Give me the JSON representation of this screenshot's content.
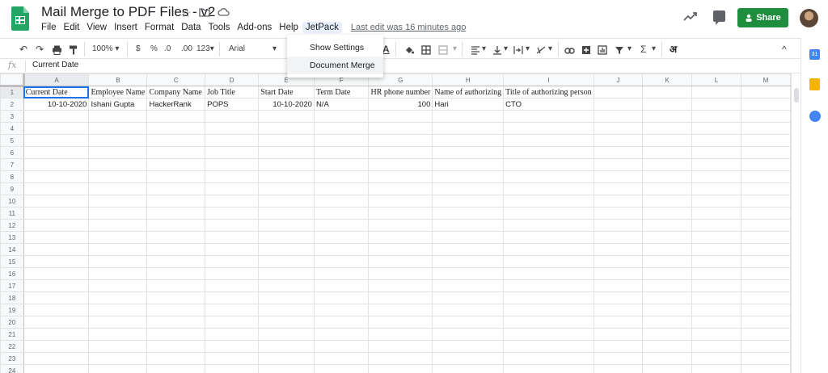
{
  "app": {
    "title": "Mail Merge to PDF Files - v2",
    "last_edit": "Last edit was 16 minutes ago",
    "share_label": "Share"
  },
  "menu": [
    "File",
    "Edit",
    "View",
    "Insert",
    "Format",
    "Data",
    "Tools",
    "Add-ons",
    "Help",
    "JetPack"
  ],
  "toolbar": {
    "zoom": "100%",
    "currency": "$",
    "percent": "%",
    "dec_decrease": ".0",
    "dec_increase": ".00",
    "format_more": "123",
    "font": "Arial",
    "hindi_glyph": "अ"
  },
  "formula_bar": {
    "fx": "fx",
    "value": "Current Date"
  },
  "dropdown": {
    "items": [
      "Show Settings",
      "Document Merge"
    ]
  },
  "sheet": {
    "columns": [
      "A",
      "B",
      "C",
      "D",
      "E",
      "F",
      "G",
      "H",
      "I",
      "J",
      "K",
      "L",
      "M"
    ],
    "rows": [
      "1",
      "2",
      "3",
      "4",
      "5",
      "6",
      "7",
      "8",
      "9",
      "10",
      "11",
      "12",
      "13",
      "14",
      "15",
      "16",
      "17",
      "18",
      "19",
      "20",
      "21",
      "22",
      "23",
      "24"
    ],
    "header_row": [
      "Current Date",
      "Employee Name",
      "Company Name",
      "Job Title",
      "Start Date",
      "Term Date",
      "HR phone number",
      "Name of authorizing",
      "Title of authorizing person",
      "",
      "",
      "",
      ""
    ],
    "data_row": [
      "10-10-2020",
      "Ishani Gupta",
      "HackerRank",
      "POPS",
      "10-10-2020",
      "N/A",
      "100",
      "Hari",
      "CTO",
      "",
      "",
      "",
      ""
    ]
  },
  "colors": {
    "share_green": "#1e8e3e",
    "sheets_green": "#23a566",
    "selection_blue": "#1a73e8"
  }
}
